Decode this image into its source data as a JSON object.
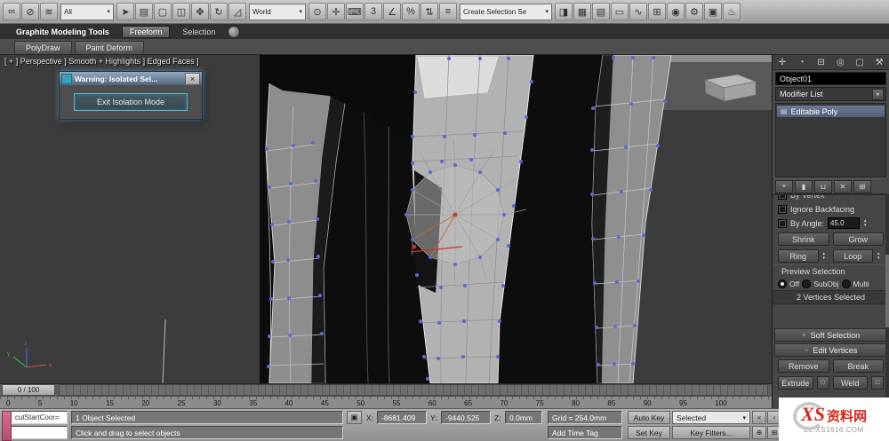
{
  "ui": {
    "arrow_down": "▾",
    "spinner_up": "▲",
    "spinner_down": "▼"
  },
  "toolbar": {
    "filter_value": "All",
    "coord_value": "World",
    "selection_set_value": "Create Selection Se",
    "group1": [
      {
        "name": "select-and-link-icon",
        "glyph": "∞"
      },
      {
        "name": "unlink-selection-icon",
        "glyph": "⊘"
      },
      {
        "name": "bind-to-space-warp-icon",
        "glyph": "≋"
      }
    ],
    "group2": [
      {
        "name": "select-object-icon",
        "glyph": "➤"
      },
      {
        "name": "select-by-name-icon",
        "glyph": "▤"
      },
      {
        "name": "rectangular-selection-region-icon",
        "glyph": "▢"
      },
      {
        "name": "window-crossing-icon",
        "glyph": "◫"
      },
      {
        "name": "select-and-move-icon",
        "glyph": "✥"
      },
      {
        "name": "select-and-rotate-icon",
        "glyph": "↻"
      },
      {
        "name": "select-and-scale-icon",
        "glyph": "◿"
      }
    ],
    "group3": [
      {
        "name": "use-pivot-point-center-icon",
        "glyph": "⊙"
      },
      {
        "name": "select-and-manipulate-icon",
        "glyph": "✛"
      },
      {
        "name": "keyboard-shortcut-override-icon",
        "glyph": "⌨"
      },
      {
        "name": "snap-toggle-icon",
        "glyph": "3"
      },
      {
        "name": "angle-snap-icon",
        "glyph": "∠"
      },
      {
        "name": "percent-snap-icon",
        "glyph": "%"
      },
      {
        "name": "spinner-snap-icon",
        "glyph": "⇅"
      },
      {
        "name": "named-selection-sets-icon",
        "glyph": "≡"
      }
    ],
    "group4": [
      {
        "name": "mirror-icon",
        "glyph": "◨"
      },
      {
        "name": "align-icon",
        "glyph": "▦"
      },
      {
        "name": "layer-manager-icon",
        "glyph": "▤"
      },
      {
        "name": "graphite-ribbon-toggle-icon",
        "glyph": "▭"
      },
      {
        "name": "curve-editor-icon",
        "glyph": "∿"
      },
      {
        "name": "schematic-view-icon",
        "glyph": "⊞"
      },
      {
        "name": "material-editor-icon",
        "glyph": "◉"
      },
      {
        "name": "render-setup-icon",
        "glyph": "⚙"
      },
      {
        "name": "rendered-frame-icon",
        "glyph": "▣"
      },
      {
        "name": "render-production-icon",
        "glyph": "♨"
      }
    ]
  },
  "ribbon": {
    "tab1": "Graphite Modeling Tools",
    "tab2": "Freeform",
    "tab3": "Selection",
    "subtab1": "PolyDraw",
    "subtab2": "Paint Deform"
  },
  "viewport": {
    "label": "[ + ] Perspective ] Smooth + Highlights ] Edged Faces ]",
    "axis_x": "x",
    "axis_y": "y",
    "axis_z": "z"
  },
  "dialog": {
    "title": "Warning: Isolated Sel...",
    "close_glyph": "×",
    "button_label": "Exit Isolation Mode"
  },
  "panel": {
    "tabs": [
      {
        "name": "create-panel-icon",
        "glyph": "✛"
      },
      {
        "name": "modify-panel-icon",
        "glyph": "◔"
      },
      {
        "name": "hierarchy-panel-icon",
        "glyph": "⊟"
      },
      {
        "name": "motion-panel-icon",
        "glyph": "◎"
      },
      {
        "name": "display-panel-icon",
        "glyph": "▢"
      },
      {
        "name": "utilities-panel-icon",
        "glyph": "⚒"
      }
    ],
    "object_name": "Object01",
    "modifier_list_label": "Modifier List",
    "stack_item": "Editable Poly",
    "stack_icon_glyph": "▤",
    "stack_tools": [
      {
        "name": "pin-stack-icon",
        "glyph": "⌖"
      },
      {
        "name": "show-end-result-icon",
        "glyph": "▮"
      },
      {
        "name": "make-unique-icon",
        "glyph": "⊔"
      },
      {
        "name": "remove-modifier-icon",
        "glyph": "✕"
      },
      {
        "name": "configure-modifier-sets-icon",
        "glyph": "⊞"
      }
    ],
    "rollout": {
      "by_vertex": "By Vertex",
      "ignore_backfacing": "Ignore Backfacing",
      "by_angle": "By Angle:",
      "angle_value": "45.0",
      "shrink": "Shrink",
      "grow": "Grow",
      "ring": "Ring",
      "loop": "Loop",
      "preview_selection": "Preview Selection",
      "radio_off": "Off",
      "radio_subobj": "SubObj",
      "radio_multi": "Multi",
      "selection_info": "2 Vertices Selected",
      "soft_selection": "Soft Selection",
      "soft_pm": "+",
      "edit_vertices": "Edit Vertices",
      "edit_pm": "−",
      "remove": "Remove",
      "break_label": "Break",
      "extrude": "Extrude",
      "weld": "Weld",
      "settings_glyph": "□"
    }
  },
  "timeline": {
    "handle_label": "0 / 100",
    "ruler": [
      "0",
      "5",
      "10",
      "15",
      "20",
      "25",
      "30",
      "35",
      "40",
      "45",
      "50",
      "55",
      "60",
      "65",
      "70",
      "75",
      "80",
      "85",
      "90",
      "95",
      "100"
    ]
  },
  "status": {
    "listener_text": "cutStartCoor=",
    "object_selected": "1 Object Selected",
    "prompt": "Click and drag to select objects",
    "lock_glyph": "▣",
    "x_label": "X:",
    "x_value": "-8681.409",
    "y_label": "Y:",
    "y_value": "-9440.525",
    "z_label": "Z:",
    "z_value": "0.0mm",
    "grid_label": "Grid = 254.0mm",
    "add_time_tag": "Add Time Tag",
    "auto_key": "Auto Key",
    "set_key": "Set Key",
    "selected_value": "Selected",
    "key_filters": "Key Filters...",
    "transport": [
      {
        "name": "go-to-start-icon",
        "glyph": "«"
      },
      {
        "name": "previous-frame-icon",
        "glyph": "‹"
      },
      {
        "name": "play-animation-icon",
        "glyph": "▶"
      },
      {
        "name": "next-frame-icon",
        "glyph": "›"
      },
      {
        "name": "go-to-end-icon",
        "glyph": "»"
      }
    ],
    "nav": [
      {
        "name": "zoom-icon",
        "glyph": "⊕"
      },
      {
        "name": "zoom-all-icon",
        "glyph": "⊞"
      },
      {
        "name": "zoom-extents-icon",
        "glyph": "⊡"
      },
      {
        "name": "pan-icon",
        "glyph": "✥"
      },
      {
        "name": "orbit-icon",
        "glyph": "↻"
      }
    ]
  },
  "watermark": {
    "xs": "XS",
    "zh": "资料网",
    "url": "ZL.XS1616.COM"
  }
}
